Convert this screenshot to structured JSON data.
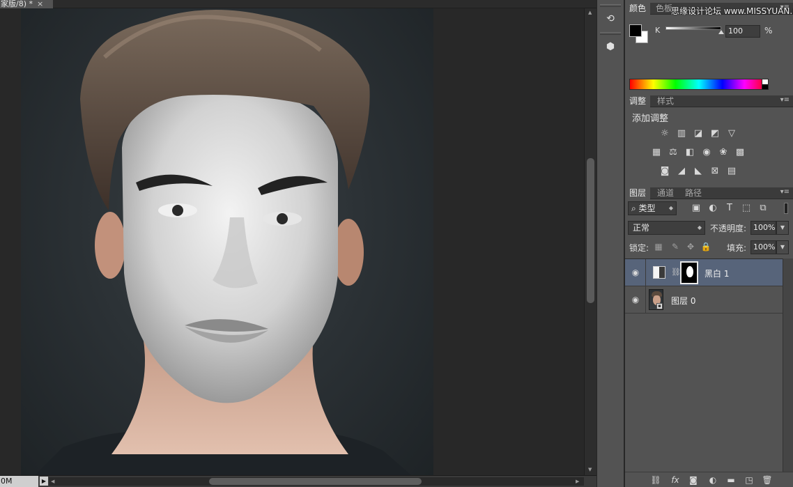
{
  "document": {
    "tab_title": "家版/8) *",
    "close_glyph": "×",
    "zoom": "0M"
  },
  "dock": {
    "tools": [
      "history-icon",
      "3d-icon"
    ]
  },
  "color_panel": {
    "tabs": [
      "颜色",
      "色板"
    ],
    "channel_label": "K",
    "channel_value": "100",
    "unit": "%",
    "foreground": "#000000",
    "background": "#ffffff"
  },
  "watermark": "思缘设计论坛 www.MISSYUAN.COM",
  "adjustments_panel": {
    "tabs": [
      "调整",
      "样式"
    ],
    "title": "添加调整",
    "icons": [
      "brightness-icon",
      "levels-icon",
      "curves-icon",
      "exposure-icon",
      "vibrance-icon",
      "hue-saturation-icon",
      "color-balance-icon",
      "black-white-icon",
      "photo-filter-icon",
      "channel-mixer-icon",
      "color-lookup-icon",
      "invert-icon",
      "posterize-icon",
      "threshold-icon",
      "selective-color-icon",
      "gradient-map-icon"
    ]
  },
  "layers_panel": {
    "tabs": [
      "图层",
      "通道",
      "路径"
    ],
    "filter_label": "类型",
    "blend_mode": "正常",
    "opacity_label": "不透明度:",
    "opacity_value": "100%",
    "lock_label": "锁定:",
    "fill_label": "填充:",
    "fill_value": "100%",
    "layers": [
      {
        "name": "黑白 1",
        "visible": true,
        "selected": true,
        "kind": "adjustment"
      },
      {
        "name": "图层 0",
        "visible": true,
        "selected": false,
        "kind": "pixel"
      }
    ],
    "footer_icons": [
      "link-icon",
      "fx-icon",
      "mask-icon",
      "adjustment-icon",
      "group-icon",
      "new-layer-icon",
      "delete-icon"
    ]
  },
  "accent_colors": {
    "selected_layer": "#57647a",
    "panel_bg": "#535353",
    "canvas_bg": "#282828"
  }
}
